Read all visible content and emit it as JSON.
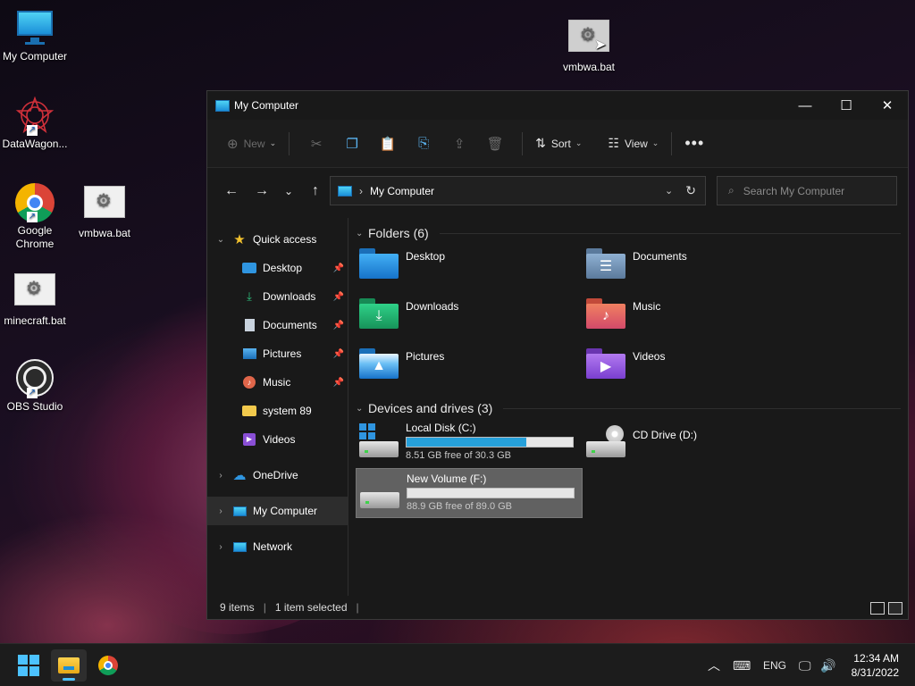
{
  "desktop": {
    "icons": [
      {
        "label": "My Computer",
        "icon": "monitor-icon"
      },
      {
        "label": "DataWagon...",
        "icon": "datawagon-logo-icon"
      },
      {
        "label": "Google Chrome",
        "icon": "chrome-icon"
      },
      {
        "label": "vmbwa.bat",
        "icon": "batch-file-icon"
      },
      {
        "label": "minecraft.bat",
        "icon": "batch-file-icon"
      },
      {
        "label": "OBS Studio",
        "icon": "obs-icon"
      },
      {
        "label": "vmbwa.bat",
        "icon": "batch-file-icon"
      }
    ]
  },
  "window": {
    "title": "My Computer",
    "toolbar": {
      "new_label": "New",
      "sort_label": "Sort",
      "view_label": "View"
    },
    "address": {
      "path": "My Computer"
    },
    "search": {
      "placeholder": "Search My Computer"
    },
    "nav": {
      "quick_access": "Quick access",
      "items": [
        {
          "label": "Desktop",
          "pinned": true
        },
        {
          "label": "Downloads",
          "pinned": true
        },
        {
          "label": "Documents",
          "pinned": true
        },
        {
          "label": "Pictures",
          "pinned": true
        },
        {
          "label": "Music",
          "pinned": true
        },
        {
          "label": "system 89",
          "pinned": false
        },
        {
          "label": "Videos",
          "pinned": false
        }
      ],
      "onedrive": "OneDrive",
      "my_computer": "My Computer",
      "network": "Network"
    },
    "folders_header": "Folders (6)",
    "folders": [
      {
        "name": "Desktop",
        "color": "#1e90ff"
      },
      {
        "name": "Documents",
        "color": "#6d8fb5"
      },
      {
        "name": "Downloads",
        "color": "#1fae6b"
      },
      {
        "name": "Music",
        "color": "#e0664a"
      },
      {
        "name": "Pictures",
        "color": "#2f95e0"
      },
      {
        "name": "Videos",
        "color": "#8a4fd6"
      }
    ],
    "drives_header": "Devices and drives (3)",
    "drives": [
      {
        "name": "Local Disk (C:)",
        "free": "8.51 GB free of 30.3 GB",
        "used_fraction": 0.72
      },
      {
        "name": "CD Drive (D:)"
      },
      {
        "name": "New Volume (F:)",
        "free": "88.9 GB free of 89.0 GB",
        "used_fraction": 0.0
      }
    ],
    "status": {
      "items": "9 items",
      "selected": "1 item selected"
    }
  },
  "taskbar": {
    "language": "ENG",
    "time": "12:34 AM",
    "date": "8/31/2022"
  }
}
